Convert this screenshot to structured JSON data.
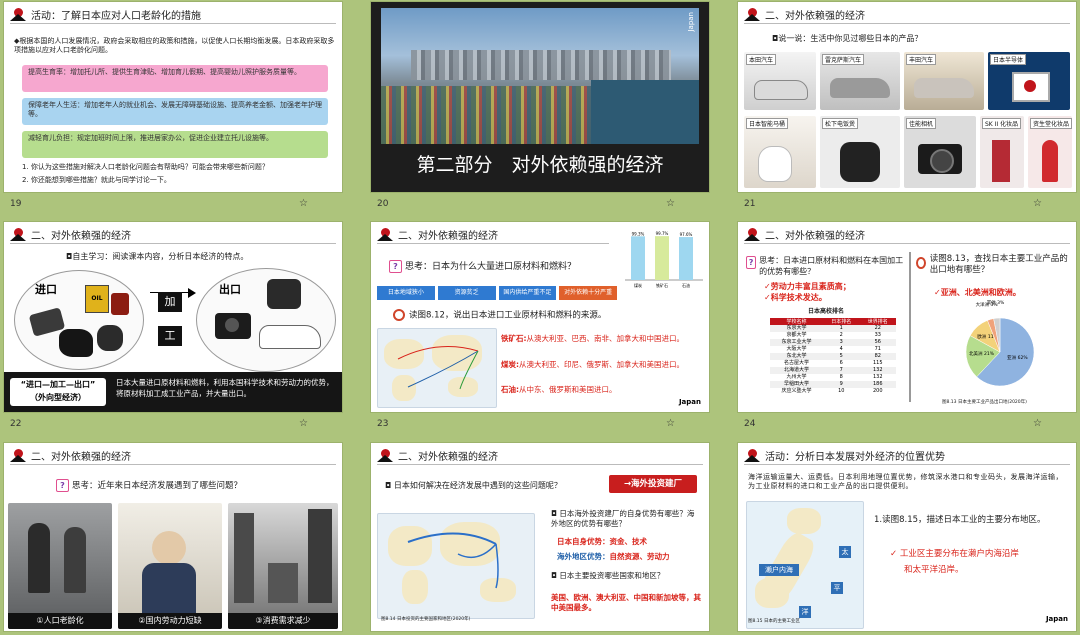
{
  "colors": {
    "bg": "#adc47c",
    "accent_red": "#d9241b",
    "pink": "#f6a7cf",
    "blue": "#a9d4f0",
    "green": "#b6dd8e"
  },
  "slides": [
    {
      "num": "19",
      "title": "活动：了解日本应对人口老龄化的措施",
      "intro": "◆根据本国的人口发展情况，政府会采取相应的政策和措施，以促使人口长期均衡发展。日本政府采取多项措施以应对人口老龄化问题。",
      "pink": "提高生育率：增加托儿所、提供生育津贴、增加育儿假期、提高婴幼儿照护服务质量等。",
      "blue": "保障老年人生活：增加老年人的就业机会、发展无障碍基础设施、提高养老金额、加强老年护理等。",
      "green": "减轻育儿负担：规定加班时间上限，推进居家办公，促进企业建立托儿设施等。",
      "q1": "1. 你认为这些措施对解决人口老龄化问题会有帮助吗？可能会带来哪些新问题？",
      "q2": "2. 你还能想到哪些措施？就此与同学讨论一下。"
    },
    {
      "num": "20",
      "title": "第二部分　对外依赖强的经济",
      "tag": "Japan"
    },
    {
      "num": "21",
      "title": "二、对外依赖强的经济",
      "ask": "◘说一说：生活中你见过哪些日本的产品？",
      "products": [
        "本田汽车",
        "雷克萨斯汽车",
        "丰田汽车",
        "日本半导体",
        "日本智能马桶",
        "松下电饭煲",
        "佳能相机",
        "SK II 化妆品",
        "资生堂化妆品"
      ]
    },
    {
      "num": "22",
      "title": "二、对外依赖强的经济",
      "ask": "◘自主学习：阅读课本内容，分析日本经济的特点。",
      "in": "进口",
      "out": "出口",
      "ja": "加",
      "gong": "工",
      "model": "“进口—加工—出口”\n（外向型经济）",
      "desc": "日本大量进口原材料和燃料，利用本国科学技术和劳动力的优势，将原材料加工成工业产品，并大量出口。",
      "oil": "OIL"
    },
    {
      "num": "23",
      "title": "二、对外依赖强的经济",
      "think": "思考：日本为什么大量进口原材料和燃料？",
      "chain": [
        "日本地域狭小",
        "资源贫乏",
        "国内供给严重不足",
        "对外依赖十分严重"
      ],
      "read": "读图8.12，说出日本进口工业原材料和燃料的来源。",
      "ore_l": "铁矿石:",
      "ore": "从澳大利亚、巴西、南非、加拿大和中国进口。",
      "coal_l": "煤炭:",
      "coal": "从澳大利亚、印尼、俄罗斯、加拿大和美国进口。",
      "oil_l": "石油:",
      "oil": "从中东、俄罗斯和美国进口。",
      "tag": "Japan",
      "bars": [
        {
          "label": "煤炭",
          "value": 99.3
        },
        {
          "label": "铁矿石",
          "value": 99.7
        },
        {
          "label": "石油",
          "value": 97.6
        }
      ]
    },
    {
      "num": "24",
      "title": "二、对外依赖强的经济",
      "think": "思考：日本进口原材料和燃料在本国加工的优势有哪些？",
      "adv1": "✓劳动力丰富且素质高；",
      "adv2": "✓科学技术发达。",
      "tbl_title": "日本高校排名",
      "tbl_head": [
        "学校名称",
        "日本排名",
        "世界排名"
      ],
      "tbl": [
        [
          "东京大学",
          "1",
          "22"
        ],
        [
          "京都大学",
          "2",
          "33"
        ],
        [
          "东京工业大学",
          "3",
          "56"
        ],
        [
          "大阪大学",
          "4",
          "71"
        ],
        [
          "东北大学",
          "5",
          "82"
        ],
        [
          "名古屋大学",
          "6",
          "115"
        ],
        [
          "北海道大学",
          "7",
          "132"
        ],
        [
          "九州大学",
          "8",
          "132"
        ],
        [
          "早稲田大学",
          "9",
          "186"
        ],
        [
          "庆应义塾大学",
          "10",
          "200"
        ]
      ],
      "read": "读图8.13，查找日本主要工业产品的出口地有哪些？",
      "ans": "✓亚洲、北美洲和欧洲。",
      "cap": "图8.13 日本主要工业产品出口地(2020年)",
      "pie": [
        {
          "label": "亚洲",
          "value": 62
        },
        {
          "label": "北美洲",
          "value": 21
        },
        {
          "label": "欧洲",
          "value": 11
        },
        {
          "label": "大洋洲",
          "value": 3
        },
        {
          "label": "其他",
          "value": 3
        }
      ]
    },
    {
      "num": "25",
      "title": "二、对外依赖强的经济",
      "think": "思考：近年来日本经济发展遇到了哪些问题？",
      "p1": "①人口老龄化",
      "p2": "②国内劳动力短缺",
      "p3": "③消费需求减少"
    },
    {
      "num": "26",
      "title": "二、对外依赖强的经济",
      "ask": "◘ 日本如何解决在经济发展中遇到的这些问题呢？",
      "btn": "→海外投资建厂",
      "q1": "◘ 日本海外投资建厂的自身优势有哪些？海外地区的优势有哪些？",
      "a1_l": "日本自身优势：",
      "a1": "资金、技术",
      "a2_l": "海外地区优势：",
      "a2": "自然资源、劳动力",
      "q2": "◘ 日本主要投资哪些国家和地区？",
      "a3": "美国、欧洲、澳大利亚、中国和新加坡等，其中美国最多。",
      "cap": "图8.14 日本投资的主要国家和地区(2020年)"
    },
    {
      "num": "27",
      "title": "活动：分析日本发展对外经济的位置优势",
      "para": "海洋运输运量大、运费低。日本利用地理位置优势，修筑深水港口和专业码头，发展海洋运输，为工业原材料的进口和工业产品的出口提供便利。",
      "q": "1.读图8.15，描述日本工业的主要分布地区。",
      "ans1": "✓ 工业区主要分布在濑户内海沿岸",
      "ans2": "和太平洋沿岸。",
      "sea": "濑户内海",
      "m1": "太",
      "m2": "平",
      "m3": "洋",
      "tag": "Japan",
      "cap": "图8.15 日本的主要工业区"
    }
  ]
}
